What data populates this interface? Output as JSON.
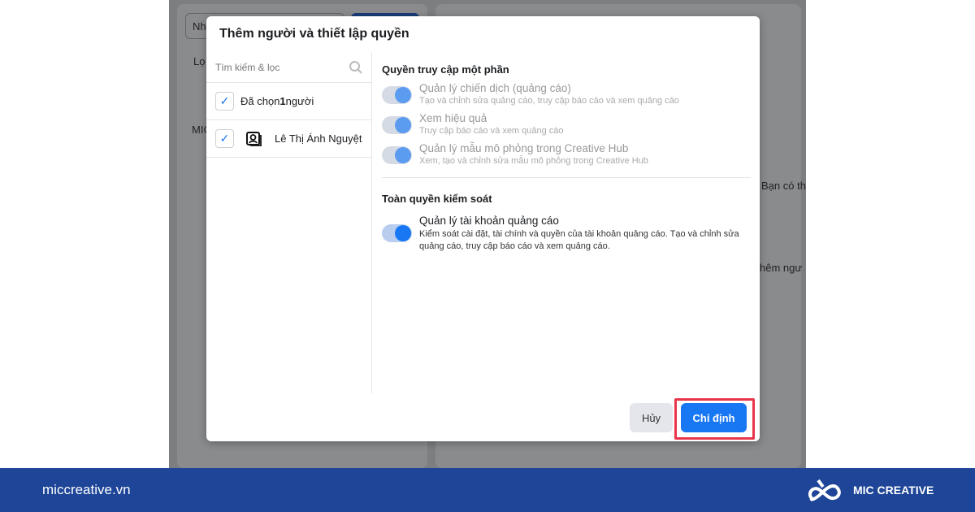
{
  "background": {
    "search_placeholder": "Nh",
    "filter_label": "Lọ",
    "account_label": "MIC",
    "side_text_1": "Bạn có th",
    "side_text_2": "hêm ngư"
  },
  "modal": {
    "title": "Thêm người và thiết lập quyền",
    "search_placeholder": "Tìm kiếm & lọc",
    "selected_prefix": "Đã chọn ",
    "selected_count": "1",
    "selected_suffix": " người",
    "person_name": "Lê Thị Ánh Nguyệt",
    "partial": {
      "heading": "Quyền truy cập một phần",
      "items": [
        {
          "title": "Quản lý chiến dịch (quảng cáo)",
          "desc": "Tạo và chỉnh sửa quảng cáo, truy cập báo cáo và xem quảng cáo",
          "enabled": true
        },
        {
          "title": "Xem hiệu quả",
          "desc": "Truy cập báo cáo và xem quảng cáo",
          "enabled": true
        },
        {
          "title": "Quản lý mẫu mô phỏng trong Creative Hub",
          "desc": "Xem, tạo và chỉnh sửa mẫu mô phỏng trong Creative Hub",
          "enabled": true
        }
      ]
    },
    "full": {
      "heading": "Toàn quyền kiểm soát",
      "item": {
        "title": "Quản lý tài khoản quảng cáo",
        "desc": "Kiểm soát cài đặt, tài chính và quyền của tài khoản quảng cáo. Tạo và chỉnh sửa quảng cáo, truy cập báo cáo và xem quảng cáo.",
        "enabled": true
      }
    },
    "cancel_label": "Hủy",
    "assign_label": "Chỉ định"
  },
  "footer": {
    "site": "miccreative.vn",
    "brand": "MIC CREATIVE"
  },
  "colors": {
    "accent": "#1877f2",
    "footer": "#1e4598",
    "highlight": "#e8354b"
  }
}
